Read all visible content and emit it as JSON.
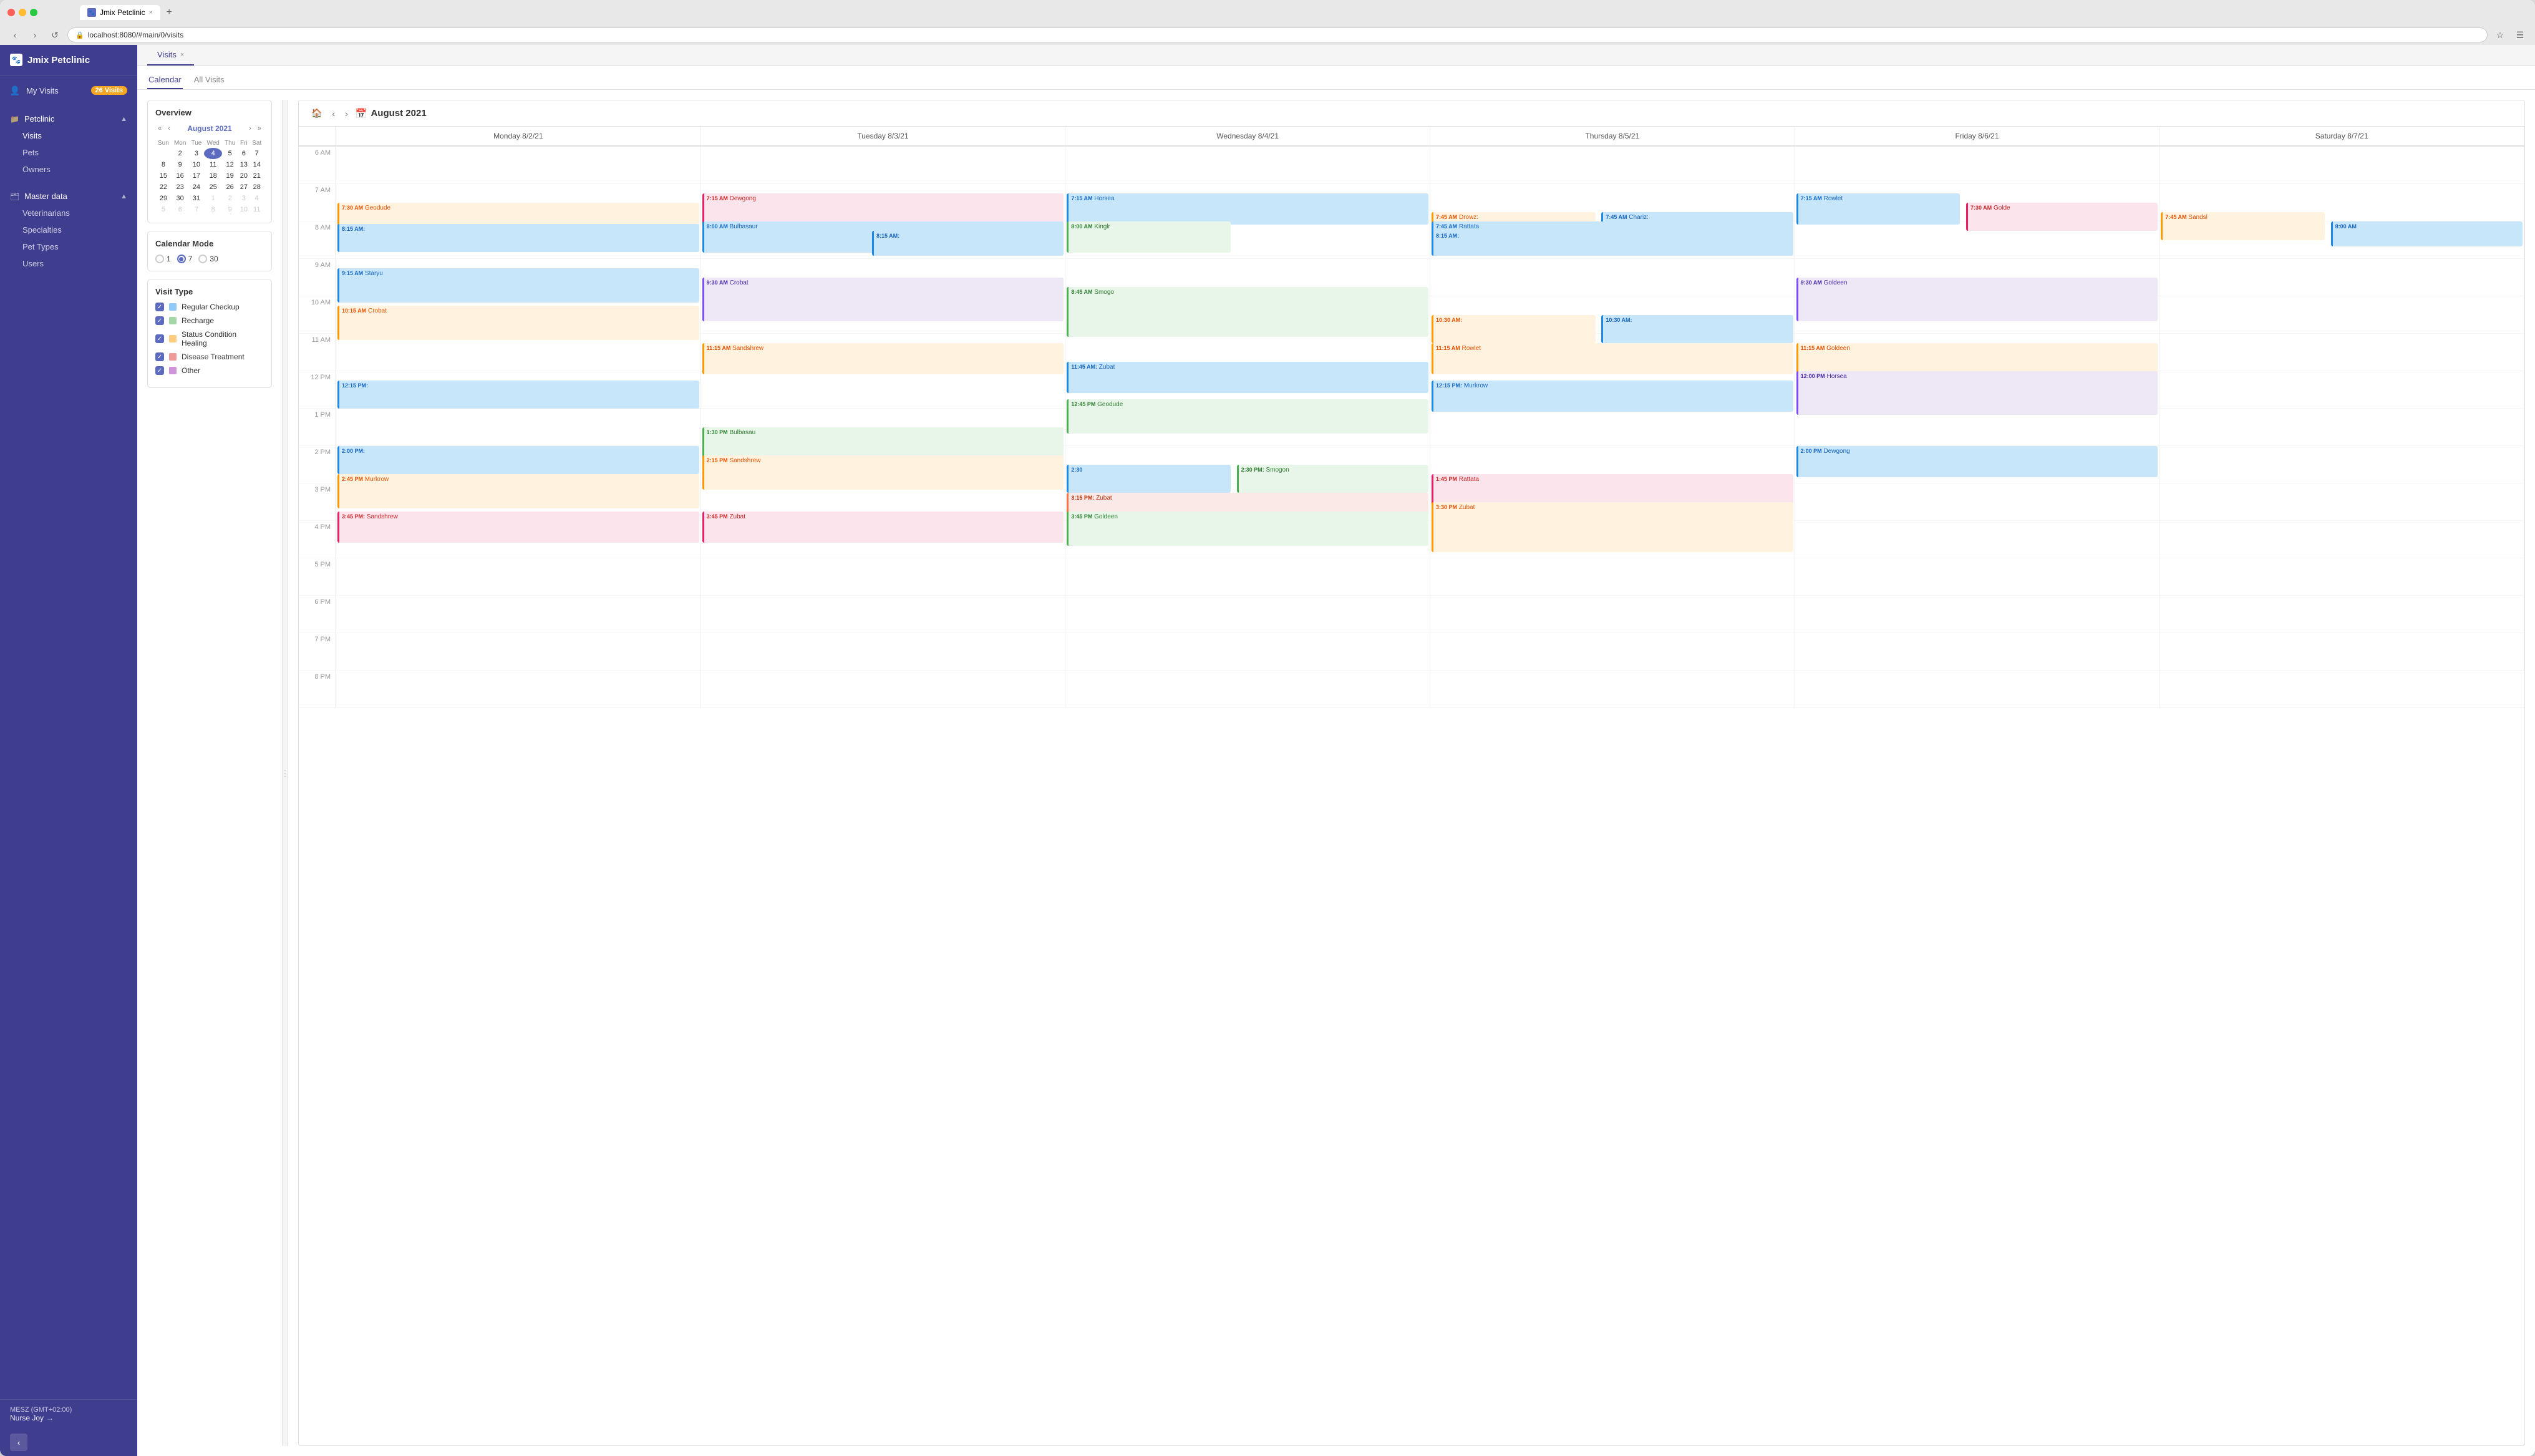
{
  "browser": {
    "tab_title": "Jmix Petclinic",
    "tab_close": "×",
    "new_tab": "+",
    "address": "localhost:8080/#main/0/visits",
    "nav_back": "‹",
    "nav_forward": "›",
    "nav_reload": "↻"
  },
  "sidebar": {
    "title": "Jmix Petclinic",
    "my_visits_label": "My Visits",
    "my_visits_badge": "26 Visits",
    "petclinic_label": "Petclinic",
    "nav_items": [
      {
        "label": "Visits",
        "active": true
      },
      {
        "label": "Pets",
        "active": false
      },
      {
        "label": "Owners",
        "active": false
      }
    ],
    "master_data_label": "Master data",
    "master_items": [
      {
        "label": "Veterinarians"
      },
      {
        "label": "Specialties"
      },
      {
        "label": "Pet Types"
      },
      {
        "label": "Users"
      }
    ],
    "footer_tz": "MESZ (GMT+02:00)",
    "footer_user": "Nurse Joy"
  },
  "content": {
    "tab_label": "Visits",
    "tab_close": "×",
    "sub_tabs": [
      {
        "label": "Calendar",
        "active": true
      },
      {
        "label": "All Visits",
        "active": false
      }
    ]
  },
  "overview": {
    "title": "Overview",
    "month": "August 2021",
    "days_header": [
      "Sun",
      "Mon",
      "Tue",
      "Wed",
      "Thu",
      "Fri",
      "Sat"
    ],
    "weeks": [
      [
        "",
        "2",
        "3",
        "4",
        "5",
        "6",
        "7"
      ],
      [
        "8",
        "9",
        "10",
        "11",
        "12",
        "13",
        "14"
      ],
      [
        "15",
        "16",
        "17",
        "18",
        "19",
        "20",
        "21"
      ],
      [
        "22",
        "23",
        "24",
        "25",
        "26",
        "27",
        "28"
      ],
      [
        "29",
        "30",
        "31",
        "1",
        "2",
        "3",
        "4"
      ],
      [
        "5",
        "6",
        "7",
        "8",
        "9",
        "10",
        "11"
      ]
    ]
  },
  "calendar_mode": {
    "title": "Calendar Mode",
    "options": [
      {
        "label": "1",
        "value": "1",
        "selected": false
      },
      {
        "label": "7",
        "value": "7",
        "selected": true
      },
      {
        "label": "30",
        "value": "30",
        "selected": false
      }
    ]
  },
  "visit_type": {
    "title": "Visit Type",
    "types": [
      {
        "label": "Regular Checkup",
        "color": "#90caf9",
        "checked": true
      },
      {
        "label": "Recharge",
        "color": "#a5d6a7",
        "checked": true
      },
      {
        "label": "Status Condition Healing",
        "color": "#ffcc80",
        "checked": true
      },
      {
        "label": "Disease Treatment",
        "color": "#ef9a9a",
        "checked": true
      },
      {
        "label": "Other",
        "color": "#ce93d8",
        "checked": true
      }
    ]
  },
  "calendar": {
    "month_year": "August 2021",
    "days": [
      {
        "label": "Monday 8/2/21"
      },
      {
        "label": "Tuesday 8/3/21"
      },
      {
        "label": "Wednesday 8/4/21"
      },
      {
        "label": "Thursday 8/5/21"
      },
      {
        "label": "Friday 8/6/21"
      },
      {
        "label": "Saturday 8/7/21"
      }
    ],
    "time_slots": [
      "6 AM",
      "7 AM",
      "8 AM",
      "9 AM",
      "10 AM",
      "11 AM",
      "12 PM",
      "1 PM",
      "2 PM",
      "3 PM",
      "4 PM",
      "5 PM",
      "6 PM",
      "7 PM",
      "8 PM"
    ],
    "events": [
      {
        "day": 0,
        "start_pct": 41.7,
        "height_pct": 8.3,
        "time": "7:30 AM",
        "name": "Geodude",
        "color": "orange"
      },
      {
        "day": 1,
        "start_pct": 33.3,
        "height_pct": 8.3,
        "time": "7:15 AM",
        "name": "Dewgong",
        "color": "pink"
      },
      {
        "day": 1,
        "start_pct": 50.0,
        "height_pct": 8.3,
        "time": "8:15 AM",
        "name": "",
        "color": "blue"
      },
      {
        "day": 2,
        "start_pct": 41.7,
        "height_pct": 8.3,
        "time": "7:15 AM",
        "name": "Horsea",
        "color": "blue"
      },
      {
        "day": 2,
        "start_pct": 50.0,
        "height_pct": 8.3,
        "time": "8:00 AM",
        "name": "Bulbasaur",
        "color": "blue"
      },
      {
        "day": 2,
        "start_pct": 58.3,
        "height_pct": 8.3,
        "time": "8:45 AM",
        "name": "Smogo",
        "color": "green"
      },
      {
        "day": 3,
        "start_pct": 37.5,
        "height_pct": 8.3,
        "time": "7:45 AM",
        "name": "Drowz",
        "color": "orange"
      },
      {
        "day": 3,
        "start_pct": 37.5,
        "height_pct": 8.3,
        "time": "7:45 AM",
        "name": "Chariz",
        "color": "blue"
      },
      {
        "day": 3,
        "start_pct": 50.0,
        "height_pct": 8.3,
        "time": "8:00 AM",
        "name": "Kinglr",
        "color": "green"
      },
      {
        "day": 3,
        "start_pct": 62.5,
        "height_pct": 8.3,
        "time": "8:15 AM",
        "name": "",
        "color": "blue"
      }
    ]
  }
}
